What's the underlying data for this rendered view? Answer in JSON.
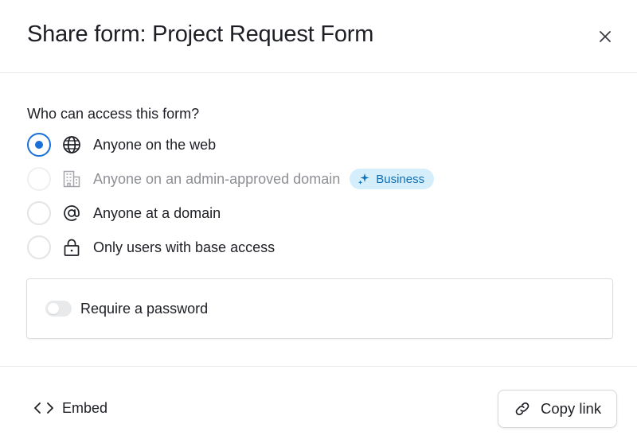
{
  "dialog": {
    "title": "Share form: Project Request Form",
    "close_icon": "close-icon"
  },
  "access": {
    "question": "Who can access this form?",
    "options": [
      {
        "label": "Anyone on the web",
        "icon": "globe-icon",
        "selected": true,
        "disabled": false
      },
      {
        "label": "Anyone on an admin-approved domain",
        "icon": "building-icon",
        "selected": false,
        "disabled": true,
        "badge": "Business"
      },
      {
        "label": "Anyone at a domain",
        "icon": "at-sign-icon",
        "selected": false,
        "disabled": false
      },
      {
        "label": "Only users with base access",
        "icon": "lock-icon",
        "selected": false,
        "disabled": false
      }
    ]
  },
  "password": {
    "label": "Require a password",
    "enabled": false
  },
  "footer": {
    "embed_label": "Embed",
    "copy_link_label": "Copy link"
  },
  "colors": {
    "accent": "#1a6fd8",
    "badge_bg": "#d4eefc",
    "badge_text": "#0f6fb5"
  }
}
